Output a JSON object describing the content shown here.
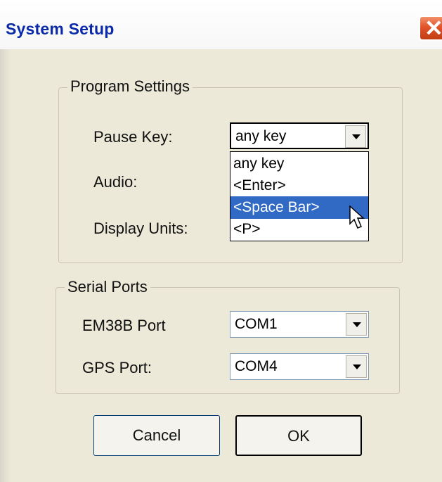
{
  "window": {
    "title": "System Setup"
  },
  "program_settings": {
    "legend": "Program Settings",
    "pause_key_label": "Pause Key:",
    "audio_label": "Audio:",
    "display_units_label": "Display Units:",
    "pause_key_value": "any key",
    "dropdown_options": [
      "any key",
      "<Enter>",
      "<Space Bar>",
      "<P>"
    ],
    "highlighted_option": "<Space Bar>"
  },
  "serial_ports": {
    "legend": "Serial Ports",
    "em38b_label": "EM38B Port",
    "em38b_value": "COM1",
    "gps_label": "GPS Port:",
    "gps_value": "COM4"
  },
  "buttons": {
    "cancel": "Cancel",
    "ok": "OK"
  },
  "colors": {
    "selection": "#316ac5",
    "title_text": "#0b2aa8",
    "dialog_bg": "#ece9d8"
  }
}
